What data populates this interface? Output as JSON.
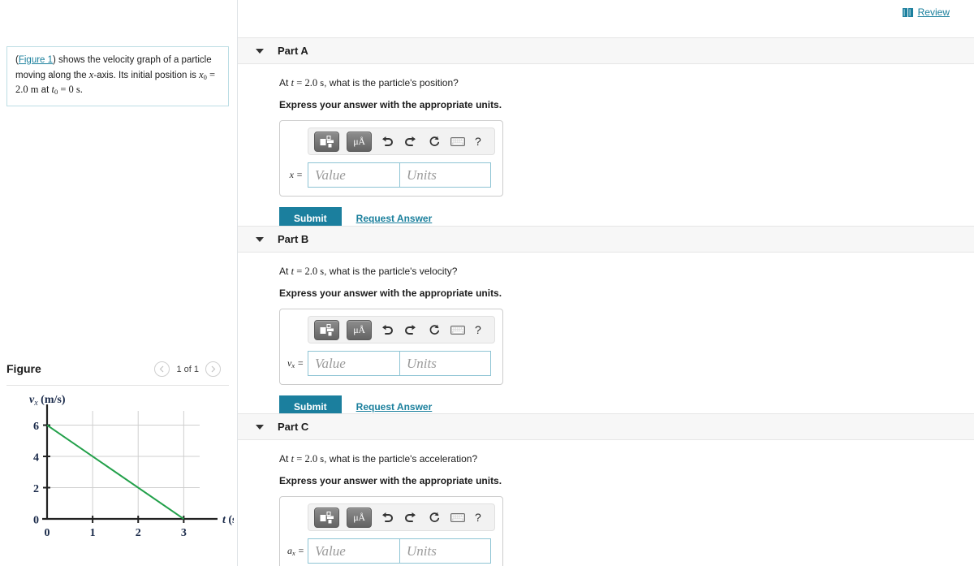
{
  "header": {
    "review_label": "Review",
    "book_icon": "book-icon"
  },
  "left": {
    "problem": {
      "figure_link": "Figure 1",
      "t1": ") shows the velocity graph of a particle moving along the ",
      "x_axis_var": "x",
      "t2": "-axis. Its initial position is ",
      "x0_var": "x",
      "x0_sub": "0",
      "x0_eq": " = 2.0 m",
      "t3": " at ",
      "t0_var": "t",
      "t0_sub": "0",
      "t0_eq": " = 0 s."
    },
    "figure": {
      "title": "Figure",
      "count_label": "1 of 1",
      "prev_icon": "chevron-left-icon",
      "next_icon": "chevron-right-icon"
    }
  },
  "chart_data": {
    "type": "line",
    "title": "",
    "xlabel": "t (s)",
    "ylabel": "v_x (m/s)",
    "ylabel_base": "v",
    "ylabel_sub": "x",
    "ylabel_unit": "(m/s)",
    "xlabel_base": "t",
    "xlabel_unit": "(s)",
    "xlim": [
      0,
      3.35
    ],
    "ylim": [
      0,
      6.6
    ],
    "xticks": [
      0,
      1,
      2,
      3
    ],
    "yticks": [
      0,
      2,
      4,
      6
    ],
    "xticklabels": [
      "0",
      "1",
      "2",
      "3"
    ],
    "yticklabels": [
      "0",
      "2",
      "4",
      "6"
    ],
    "grid": true,
    "line_color": "#22a04a",
    "series": [
      {
        "name": "v_x(t)",
        "x": [
          0,
          3
        ],
        "y": [
          6,
          0
        ]
      }
    ]
  },
  "toolbar": {
    "template_icon": "math-template-icon",
    "units_icon": "micro-angstrom-icon",
    "units_label": "μÅ",
    "undo_icon": "undo-icon",
    "redo_icon": "redo-icon",
    "reset_icon": "reset-icon",
    "keyboard_icon": "keyboard-icon",
    "help_icon": "help-icon",
    "help_label": "?"
  },
  "fields": {
    "value_placeholder": "Value",
    "units_placeholder": "Units"
  },
  "actions": {
    "submit_label": "Submit",
    "request_label": "Request Answer"
  },
  "parts": [
    {
      "label": "Part A",
      "question_prefix": "At ",
      "question_var": "t",
      "question_eq": " = 2.0 s",
      "question_suffix": ", what is the particle's position?",
      "instruction": "Express your answer with the appropriate units.",
      "var_base": "x",
      "var_sub": "",
      "var_eq": " ="
    },
    {
      "label": "Part B",
      "question_prefix": "At ",
      "question_var": "t",
      "question_eq": " = 2.0 s",
      "question_suffix": ", what is the particle's velocity?",
      "instruction": "Express your answer with the appropriate units.",
      "var_base": "v",
      "var_sub": "x",
      "var_eq": " ="
    },
    {
      "label": "Part C",
      "question_prefix": "At ",
      "question_var": "t",
      "question_eq": " = 2.0 s",
      "question_suffix": ", what is the particle's acceleration?",
      "instruction": "Express your answer with the appropriate units.",
      "var_base": "a",
      "var_sub": "x",
      "var_eq": " ="
    }
  ],
  "colors": {
    "accent": "#1b7f9e",
    "link": "#1a7f9c",
    "line": "#22a04a",
    "panel_bg": "#f7f7f7",
    "field_border": "#8ec4d4"
  }
}
